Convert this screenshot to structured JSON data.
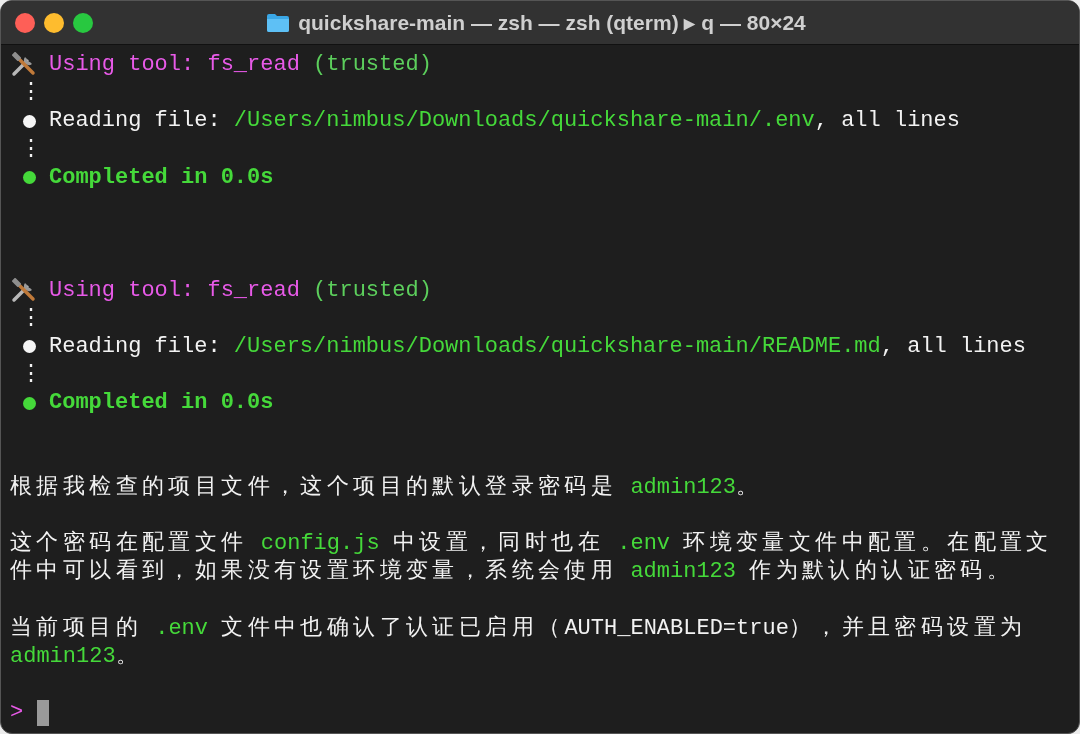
{
  "window": {
    "title": "quickshare-main — zsh — zsh (qterm) ▸ q — 80×24"
  },
  "lines": [
    {
      "kind": "tool",
      "segments": [
        {
          "kind": "tool",
          "text": "Using tool: "
        },
        {
          "kind": "tool",
          "text": "fs_read"
        },
        {
          "kind": "note",
          "text": " (trusted)"
        }
      ]
    },
    {
      "kind": "dots",
      "segments": [
        {
          "kind": "plain",
          "text": "⋮"
        }
      ]
    },
    {
      "kind": "reading",
      "segments": [
        {
          "kind": "plain",
          "text": "Reading file: "
        },
        {
          "kind": "path",
          "text": "/Users/nimbus/Downloads/quickshare-main/.env"
        },
        {
          "kind": "plain",
          "text": ", all lines"
        }
      ]
    },
    {
      "kind": "dots",
      "segments": [
        {
          "kind": "plain",
          "text": "⋮"
        }
      ]
    },
    {
      "kind": "done",
      "segments": [
        {
          "kind": "done",
          "text": "Completed in 0.0s"
        }
      ]
    },
    {
      "kind": "blank"
    },
    {
      "kind": "blank"
    },
    {
      "kind": "blank"
    },
    {
      "kind": "tool",
      "segments": [
        {
          "kind": "tool",
          "text": "Using tool: "
        },
        {
          "kind": "tool",
          "text": "fs_read"
        },
        {
          "kind": "note",
          "text": " (trusted)"
        }
      ]
    },
    {
      "kind": "dots",
      "segments": [
        {
          "kind": "plain",
          "text": "⋮"
        }
      ]
    },
    {
      "kind": "reading",
      "segments": [
        {
          "kind": "plain",
          "text": "Reading file: "
        },
        {
          "kind": "path",
          "text": "/Users/nimbus/Downloads/quickshare-main/README.md"
        },
        {
          "kind": "plain",
          "text": ", all lines"
        }
      ]
    },
    {
      "kind": "dots",
      "segments": [
        {
          "kind": "plain",
          "text": "⋮"
        }
      ]
    },
    {
      "kind": "done",
      "segments": [
        {
          "kind": "done",
          "text": "Completed in 0.0s"
        }
      ]
    },
    {
      "kind": "blank"
    },
    {
      "kind": "blank"
    },
    {
      "kind": "text",
      "segments": [
        {
          "kind": "cjk",
          "text": "根据我检查的项目文件，这个项目的默认登录密码是"
        },
        {
          "kind": "path",
          "text": " admin123"
        },
        {
          "kind": "cjk",
          "text": "。"
        }
      ]
    },
    {
      "kind": "blank"
    },
    {
      "kind": "text",
      "segments": [
        {
          "kind": "cjk",
          "text": "这个密码在配置文件"
        },
        {
          "kind": "path",
          "text": " config.js "
        },
        {
          "kind": "cjk",
          "text": "中设置，同时也在"
        },
        {
          "kind": "path",
          "text": " .env "
        },
        {
          "kind": "cjk",
          "text": "环境变量文件中配置。在配置文"
        }
      ]
    },
    {
      "kind": "text",
      "segments": [
        {
          "kind": "cjk",
          "text": "件中可以看到，如果没有设置环境变量，系统会使用"
        },
        {
          "kind": "path",
          "text": " admin123 "
        },
        {
          "kind": "cjk",
          "text": "作为默认的认证密码。"
        }
      ]
    },
    {
      "kind": "blank"
    },
    {
      "kind": "text",
      "segments": [
        {
          "kind": "cjk",
          "text": "当前项目的"
        },
        {
          "kind": "path",
          "text": " .env "
        },
        {
          "kind": "cjk",
          "text": "文件中也确认了认证已启用（"
        },
        {
          "kind": "plain",
          "text": "AUTH_ENABLED=true"
        },
        {
          "kind": "cjk",
          "text": "），并且密码设置为"
        }
      ]
    },
    {
      "kind": "text",
      "segments": [
        {
          "kind": "path",
          "text": "admin123"
        },
        {
          "kind": "cjk",
          "text": "。"
        }
      ]
    },
    {
      "kind": "blank"
    },
    {
      "kind": "prompt",
      "segments": [
        {
          "kind": "tool",
          "text": ">"
        }
      ]
    }
  ]
}
